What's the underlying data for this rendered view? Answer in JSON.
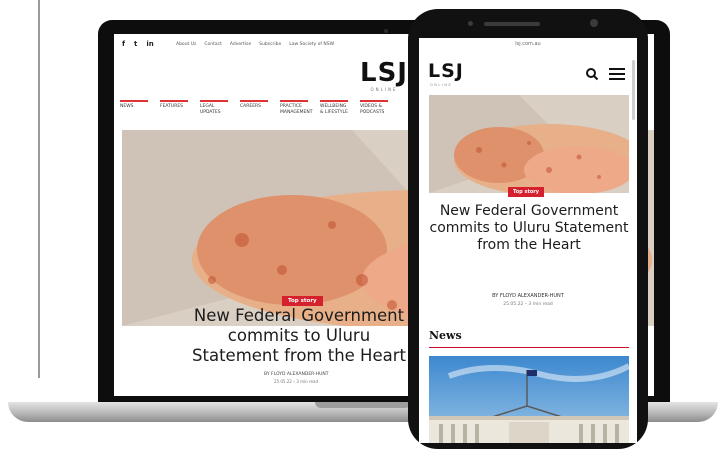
{
  "laptop": {
    "social_icons": [
      "f",
      "t",
      "in"
    ],
    "top_links": [
      "About Us",
      "Contact",
      "Advertise",
      "Subscribe",
      "Law Society of NSW"
    ],
    "logo": "LSJ",
    "logo_sub": "ONLINE",
    "nav": [
      "NEWS",
      "FEATURES",
      "LEGAL UPDATES",
      "CAREERS",
      "PRACTICE MANAGEMENT",
      "WELLBEING & LIFESTYLE",
      "VIDEOS & PODCASTS"
    ],
    "badge": "Top story",
    "headline": "New Federal Government commits to Uluru Statement from the Heart",
    "byline": "BY FLOYD ALEXANDER-HUNT",
    "date": "25.05.22 – 3 min read"
  },
  "phone": {
    "url": "lsj.com.au",
    "logo": "LSJ",
    "logo_sub": "ONLINE",
    "badge": "Top story",
    "headline": "New Federal Government commits to Uluru Statement from the Heart",
    "byline": "BY FLOYD ALEXANDER-HUNT",
    "date": "25.05.22 – 3 min read",
    "section_title": "News"
  },
  "colors": {
    "accent": "#d5202e",
    "device": "#111111",
    "skin": "#e8a27f"
  },
  "icons": [
    "search-icon",
    "menu-icon"
  ]
}
